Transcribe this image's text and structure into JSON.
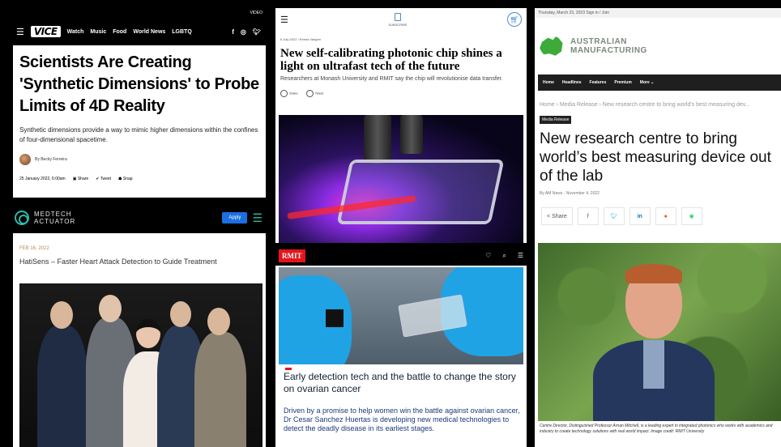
{
  "vice": {
    "top_label": "VIDEO",
    "logo": "VICE",
    "nav": [
      "Watch",
      "Music",
      "Food",
      "World News",
      "LGBTQ"
    ],
    "social_icons": [
      "facebook-icon",
      "instagram-icon",
      "twitter-icon"
    ],
    "headline": "Scientists Are Creating 'Synthetic Dimensions' to Probe Limits of 4D Reality",
    "dek": "Synthetic dimensions provide a way to mimic higher dimensions within the confines of four-dimensional spacetime.",
    "byline": "By Becky Ferreira",
    "date": "25 January 2022, 6:00am",
    "share_labels": [
      "Share",
      "Tweet",
      "Snap"
    ]
  },
  "medtech": {
    "brand_line1": "MEDTECH",
    "brand_line2": "ACTUATOR",
    "apply_label": "Apply",
    "date": "FEB 16, 2022",
    "title": "HatiSens – Faster Heart Attack Detection to Guide Treatment"
  },
  "photonic": {
    "subscribe_label": "SUBSCRIBE",
    "date_author": "6 July 2022  /  Emma Vaughn",
    "headline": "New self-calibrating photonic chip shines a light on ultrafast tech of the future",
    "dek": "Researchers at Monash University and RMIT say the chip will revolutionise data transfer.",
    "share_label": "Share",
    "tweet_label": "Tweet"
  },
  "rmit": {
    "logo": "RMIT",
    "headline": "Early detection tech and the battle to change the story on ovarian cancer",
    "body": "Driven by a promise to help women win the battle against ovarian cancer, Dr Cesar Sanchez Huertas is developing new medical technologies to detect the deadly disease in its earliest stages."
  },
  "ausman": {
    "topline": "Thursday, March 23, 2023   Sign in / Join",
    "logo_line1": "AUSTRALIAN",
    "logo_line2": "MANUFACTURING",
    "menu": [
      "Home",
      "Headlines",
      "Features",
      "Premium",
      "More ⌄"
    ],
    "breadcrumb": "Home  ›  Media Release  ›  New research centre to bring world's best measuring dev...",
    "tag": "Media Release",
    "headline": "New research centre to bring world’s best measuring device out of the lab",
    "byline": "By AM News  -  November 4, 2022",
    "share_label": "Share",
    "caption": "Centre Director, Distinguished Professor Arnan Mitchell, is a leading expert in integrated photonics who works with academics and industry to create technology solutions with real world impact. Image credit: RMIT University"
  }
}
